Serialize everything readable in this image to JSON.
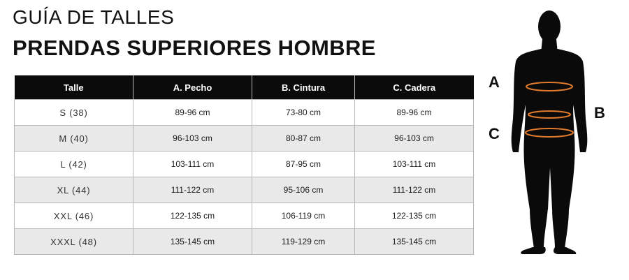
{
  "header": {
    "title_line1": "GUÍA DE TALLES",
    "title_line2": "PRENDAS SUPERIORES HOMBRE"
  },
  "table": {
    "columns": [
      "Talle",
      "A. Pecho",
      "B. Cintura",
      "C. Cadera"
    ],
    "rows": [
      {
        "size": "S (38)",
        "chest": "89-96 cm",
        "waist": "73-80 cm",
        "hip": "89-96 cm"
      },
      {
        "size": "M (40)",
        "chest": "96-103 cm",
        "waist": "80-87 cm",
        "hip": "96-103 cm"
      },
      {
        "size": "L (42)",
        "chest": "103-111 cm",
        "waist": "87-95 cm",
        "hip": "103-111 cm"
      },
      {
        "size": "XL (44)",
        "chest": "111-122 cm",
        "waist": "95-106 cm",
        "hip": "111-122 cm"
      },
      {
        "size": "XXL (46)",
        "chest": "122-135 cm",
        "waist": "106-119 cm",
        "hip": "122-135 cm"
      },
      {
        "size": "XXXL (48)",
        "chest": "135-145 cm",
        "waist": "119-129 cm",
        "hip": "135-145 cm"
      }
    ]
  },
  "figure": {
    "label_a": "A",
    "label_b": "B",
    "label_c": "C",
    "silhouette_color": "#0a0a0a",
    "measure_line_color": "#e07a2c"
  }
}
